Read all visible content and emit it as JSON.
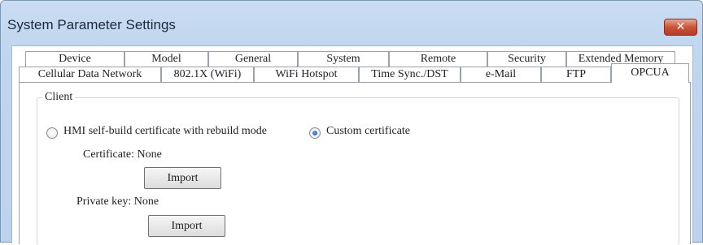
{
  "window": {
    "title": "System Parameter Settings",
    "close_glyph": "✕"
  },
  "tabs_row1": [
    "Device",
    "Model",
    "General",
    "System",
    "Remote",
    "Security",
    "Extended Memory"
  ],
  "tabs_row2": [
    "Cellular Data Network",
    "802.1X (WiFi)",
    "WiFi Hotspot",
    "Time Sync./DST",
    "e-Mail",
    "FTP",
    "OPCUA"
  ],
  "active_tab": "OPCUA",
  "client": {
    "legend": "Client",
    "radio_selfbuild_label": "HMI self-build certificate with rebuild mode",
    "radio_custom_label": "Custom certificate",
    "selected": "custom",
    "certificate_label": "Certificate: None",
    "private_key_label": "Private key: None",
    "import_label": "Import"
  },
  "colors": {
    "accent_radio": "#1b4fb0",
    "close_button": "#c95339"
  },
  "icons": {
    "close": "close-icon",
    "radio_selected": "radio-selected-icon"
  }
}
